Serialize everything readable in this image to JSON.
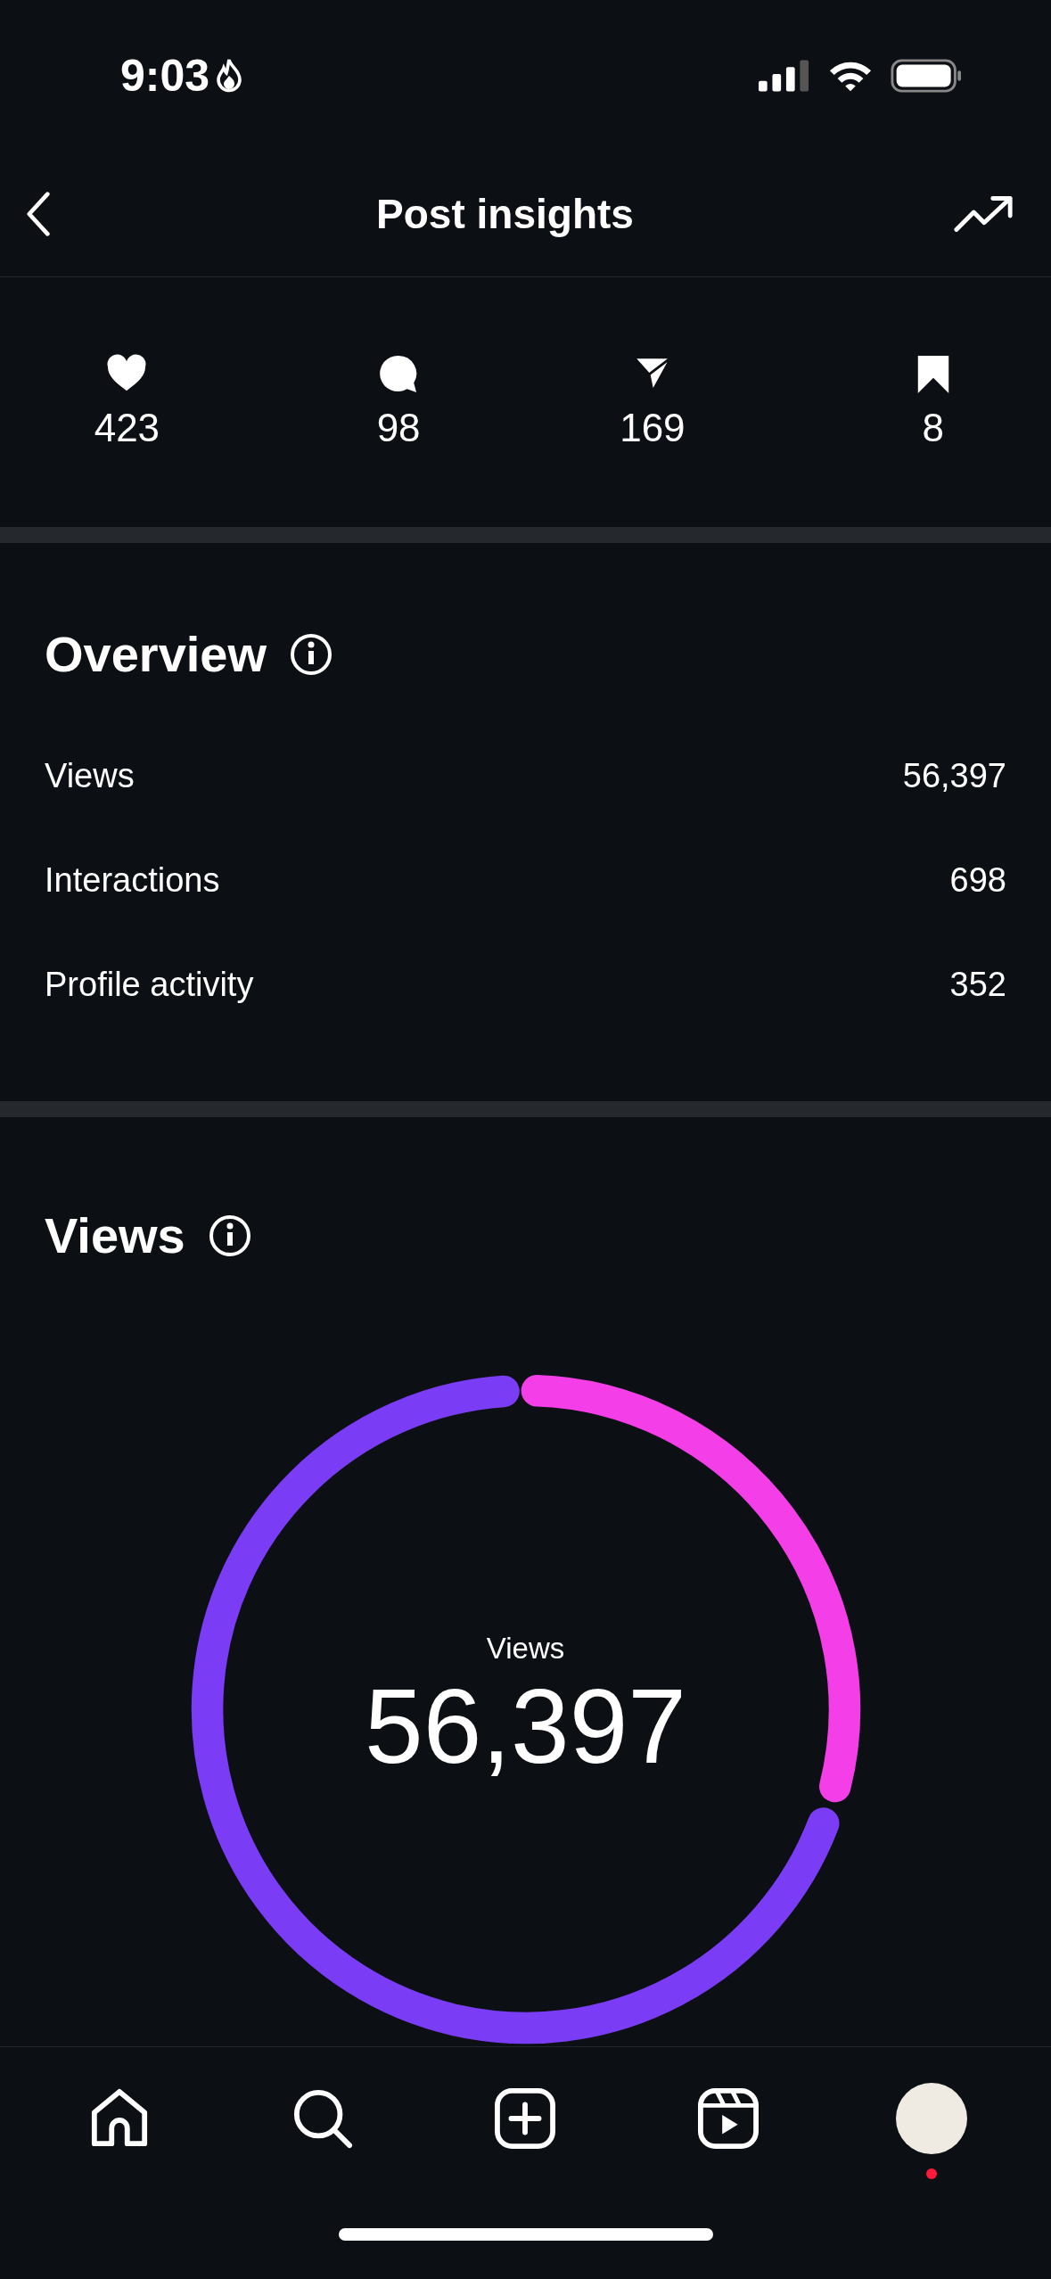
{
  "status_bar": {
    "time": "9:03"
  },
  "header": {
    "title": "Post insights"
  },
  "stats": [
    {
      "kind": "likes",
      "value": "423"
    },
    {
      "kind": "comments",
      "value": "98"
    },
    {
      "kind": "shares",
      "value": "169"
    },
    {
      "kind": "saves",
      "value": "8"
    }
  ],
  "overview": {
    "title": "Overview",
    "rows": [
      {
        "label": "Views",
        "value": "56,397"
      },
      {
        "label": "Interactions",
        "value": "698"
      },
      {
        "label": "Profile activity",
        "value": "352"
      }
    ]
  },
  "views": {
    "title": "Views",
    "center_label": "Views",
    "center_value": "56,397"
  },
  "tab_bar": {
    "items": [
      {
        "kind": "home"
      },
      {
        "kind": "search"
      },
      {
        "kind": "create"
      },
      {
        "kind": "reels"
      },
      {
        "kind": "profile",
        "badge": true
      }
    ]
  }
}
